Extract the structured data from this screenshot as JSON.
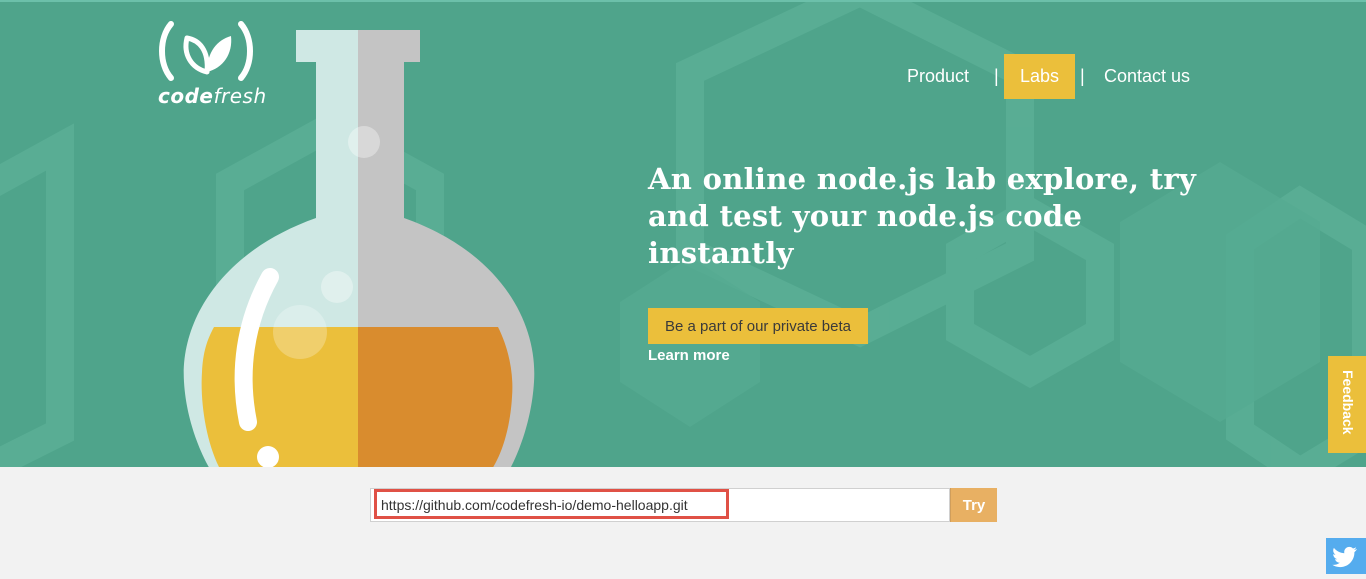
{
  "brand": {
    "name_bold": "code",
    "name_light": "fresh",
    "icon": "leaf-logo-icon"
  },
  "nav": {
    "items": [
      {
        "label": "Product"
      },
      {
        "label": "Labs",
        "active": true
      },
      {
        "label": "Contact us"
      }
    ],
    "separator": "|"
  },
  "hero": {
    "headline": "An online node.js lab explore, try and test your node.js code instantly",
    "cta_label": "Be a part of our private beta",
    "learn_more": "Learn more",
    "illustration": "flask-icon"
  },
  "feedback": {
    "label": "Feedback"
  },
  "try_bar": {
    "url_value": "https://github.com/codefresh-io/demo-helloapp.git",
    "button_label": "Try"
  },
  "social": {
    "icon": "twitter-icon"
  },
  "colors": {
    "hero_bg": "#4fa48b",
    "accent_yellow": "#ebbf3b",
    "liquid_orange": "#d98c2e",
    "try_button": "#e8b063",
    "highlight_red": "#e05146",
    "twitter_blue": "#55acee"
  }
}
